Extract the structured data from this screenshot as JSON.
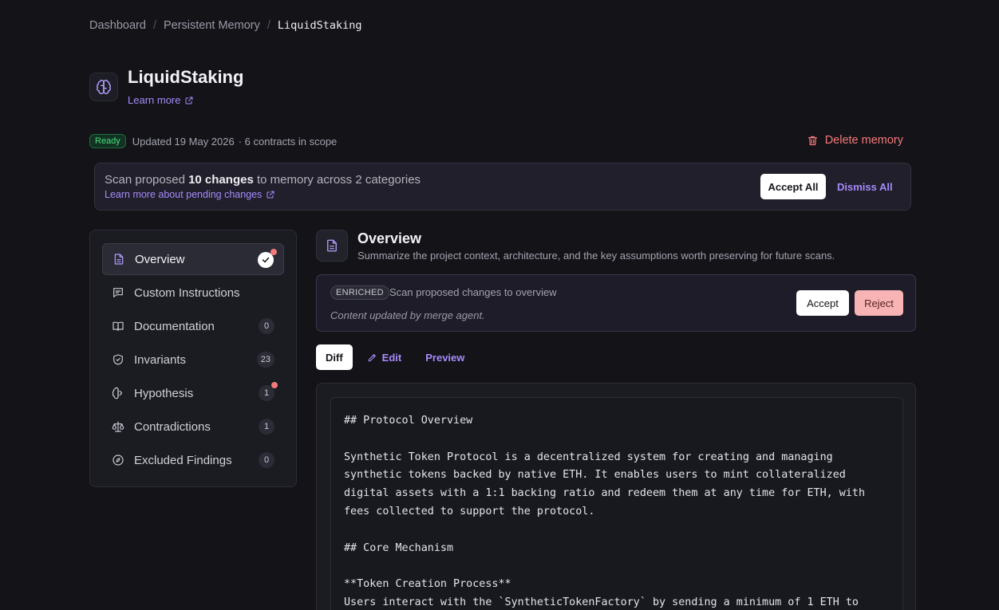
{
  "breadcrumb": {
    "items": [
      "Dashboard",
      "Persistent Memory"
    ],
    "current": "LiquidStaking"
  },
  "header": {
    "title": "LiquidStaking",
    "learn_more": "Learn more"
  },
  "status": {
    "badge": "Ready",
    "updated": "Updated 19 May 2026",
    "scope": "· 6 contracts in scope"
  },
  "actions": {
    "delete": "Delete memory"
  },
  "banner": {
    "prefix": "Scan proposed ",
    "bold": "10 changes",
    "suffix": " to memory across 2 categories",
    "link": "Learn more about pending changes",
    "accept_all": "Accept All",
    "dismiss_all": "Dismiss All"
  },
  "sidebar": {
    "items": [
      {
        "label": "Overview",
        "icon": "document-icon"
      },
      {
        "label": "Custom Instructions",
        "icon": "message-icon"
      },
      {
        "label": "Documentation",
        "icon": "book-icon",
        "count": "0"
      },
      {
        "label": "Invariants",
        "icon": "shield-icon",
        "count": "23"
      },
      {
        "label": "Hypothesis",
        "icon": "brain-icon",
        "count": "1"
      },
      {
        "label": "Contradictions",
        "icon": "scale-icon",
        "count": "1"
      },
      {
        "label": "Excluded Findings",
        "icon": "compass-icon",
        "count": "0"
      }
    ]
  },
  "section": {
    "title": "Overview",
    "subtitle": "Summarize the project context, architecture, and the key assumptions worth preserving for future scans."
  },
  "change": {
    "badge": "ENRICHED",
    "title": "Scan proposed changes to overview",
    "note": "Content updated by merge agent.",
    "accept": "Accept",
    "reject": "Reject"
  },
  "tabs": {
    "diff": "Diff",
    "edit": "Edit",
    "preview": "Preview"
  },
  "editor": {
    "content": "## Protocol Overview\n\nSynthetic Token Protocol is a decentralized system for creating and managing\nsynthetic tokens backed by native ETH. It enables users to mint collateralized\ndigital assets with a 1:1 backing ratio and redeem them at any time for ETH, with\nfees collected to support the protocol.\n\n## Core Mechanism\n\n**Token Creation Process**\nUsers interact with the `SyntheticTokenFactory` by sending a minimum of 1 ETH to"
  },
  "colors": {
    "accent": "#a78bfa",
    "danger": "#f47a7a",
    "ready": "#4ade80",
    "background": "#131318"
  }
}
